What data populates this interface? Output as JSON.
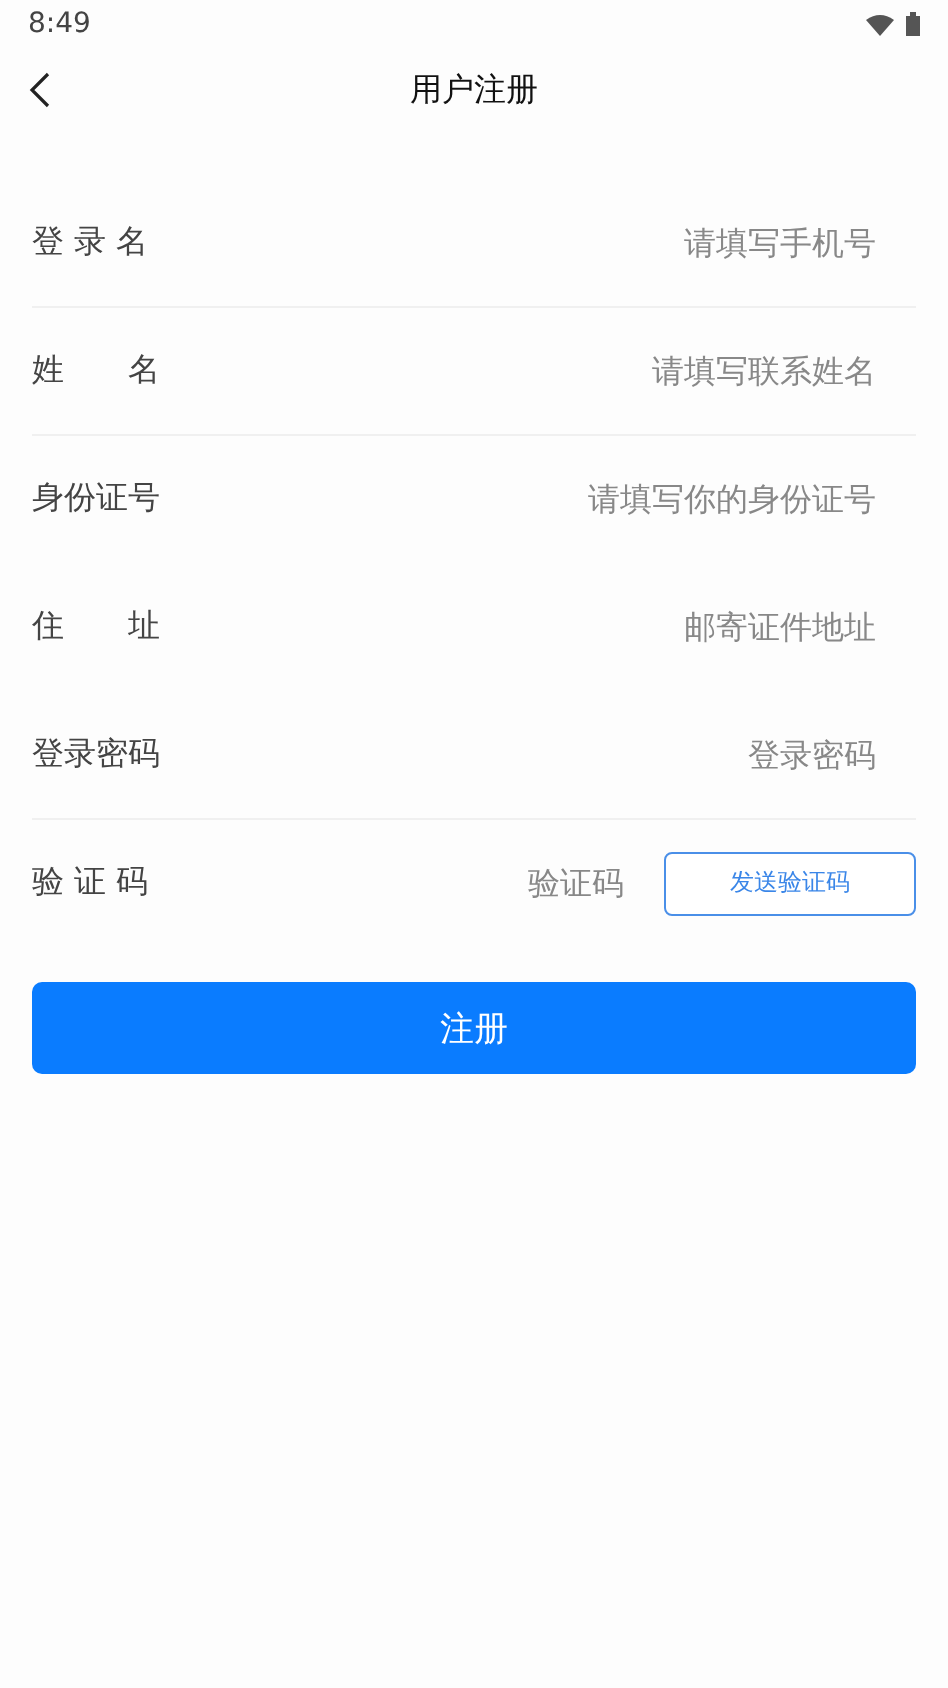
{
  "status_bar": {
    "time": "8:49"
  },
  "header": {
    "title": "用户注册"
  },
  "fields": [
    {
      "kind": "text",
      "label": "登 录 名",
      "placeholder": "请填写手机号",
      "divider": true
    },
    {
      "kind": "text",
      "label": "姓　　名",
      "placeholder": "请填写联系姓名",
      "divider": true
    },
    {
      "kind": "text",
      "label": "身份证号",
      "placeholder": "请填写你的身份证号",
      "divider": false
    },
    {
      "kind": "text",
      "label": "住　　址",
      "placeholder": "邮寄证件地址",
      "divider": false
    },
    {
      "kind": "text",
      "label": "登录密码",
      "placeholder": "登录密码",
      "divider": true
    },
    {
      "kind": "code",
      "label": "验 证 码",
      "placeholder": "验证码",
      "button": "发送验证码",
      "divider": false
    }
  ],
  "submit": "注册"
}
